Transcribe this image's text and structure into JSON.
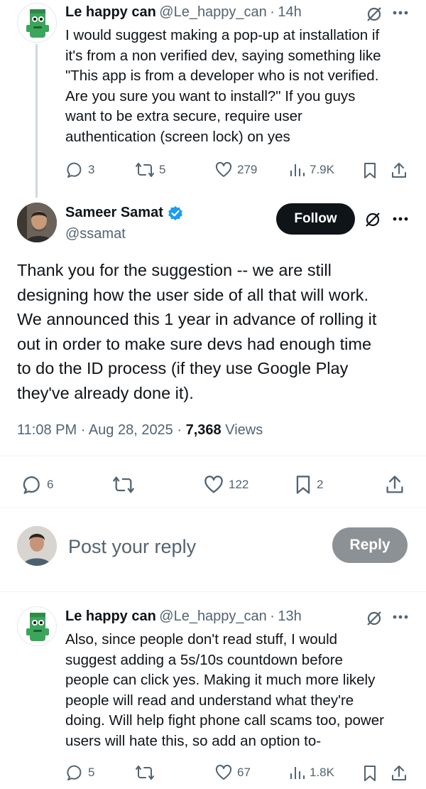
{
  "reply_above": {
    "name": "Le happy can",
    "handle": "@Le_happy_can",
    "dot": "·",
    "time": "14h",
    "lines": [
      "I would suggest making a pop-up at installation if",
      "it's from a non verified dev, saying something like",
      "\"This app is from a developer who is not verified.",
      "Are you sure you want to install?\" If you guys",
      "want to be extra secure, require user",
      "authentication (screen lock) on yes"
    ],
    "replies": "3",
    "reposts": "5",
    "likes": "279",
    "views": "7.9K"
  },
  "main_tweet": {
    "name": "Sameer Samat",
    "handle": "@ssamat",
    "follow_label": "Follow",
    "lines": [
      "Thank you for the suggestion -- we are still",
      "designing how the user side of all that will work.",
      "We announced this 1 year in advance of rolling it",
      "out in order to make sure devs had enough time",
      "to do the ID process (if they use Google Play",
      "they've already done it)."
    ],
    "time": "11:08 PM",
    "sep1": "·",
    "date": "Aug 28, 2025",
    "sep2": "·",
    "views_count": "7,368",
    "views_label": "Views",
    "replies": "6",
    "likes": "122",
    "bookmarks": "2"
  },
  "composer": {
    "placeholder": "Post your reply",
    "reply_label": "Reply"
  },
  "reply_below": {
    "name": "Le happy can",
    "handle": "@Le_happy_can",
    "dot": "·",
    "time": "13h",
    "lines": [
      "Also, since people don't read stuff, I would",
      "suggest adding a 5s/10s countdown before",
      "people can click yes. Making it much more likely",
      "people will read and understand what they're",
      "doing. Will help fight phone call scams too, power",
      "users will hate this, so add an option to-"
    ],
    "replies": "5",
    "likes": "67",
    "views": "1.8K"
  },
  "colors": {
    "text": "#0f1419",
    "muted": "#536471",
    "verified": "#1d9bf0",
    "divider": "#eff3f4",
    "follow_bg": "#0f1419",
    "reply_btn_bg": "#8c9196"
  },
  "icons": [
    "frog-avatar",
    "no-translate-icon",
    "more-icon",
    "reply-icon",
    "repost-icon",
    "like-icon",
    "views-icon",
    "bookmark-icon",
    "share-icon",
    "verified-badge-icon"
  ]
}
